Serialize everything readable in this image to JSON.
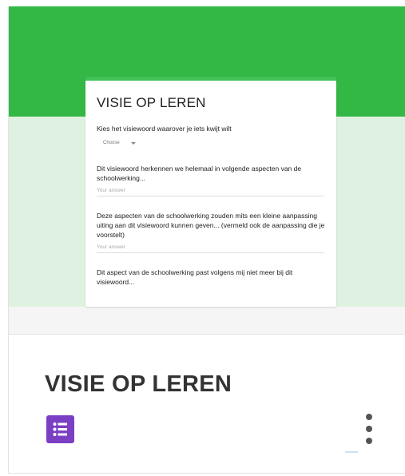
{
  "card": {
    "title": "VISIE OP LEREN",
    "form_icon": "google-forms-list-icon",
    "more_icon": "more-vertical-icon"
  },
  "preview": {
    "title": "VISIE OP LEREN",
    "questions": [
      {
        "text": "Kies het visiewoord waarover je iets kwijt wilt",
        "control": "Choose"
      },
      {
        "text": "Dit visiewoord herkennen we helemaal in volgende aspecten van de schoolwerking...",
        "placeholder": "Your answer"
      },
      {
        "text": "Deze aspecten van de schoolwerking zouden mits een kleine aanpassing uiting aan dit visiewoord kunnen geven... (vermeld ook de aanpassing die je voorstelt)",
        "placeholder": "Your answer"
      },
      {
        "text": "Dit aspect van de schoolwerking past volgens mij niet meer bij dit visiewoord..."
      }
    ]
  },
  "colors": {
    "header_green": "#33b846",
    "body_green": "#dff2e2",
    "forms_purple": "#7b3fc4"
  }
}
